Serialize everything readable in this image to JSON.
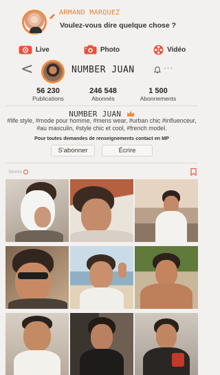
{
  "compose": {
    "user_name": "ARMAND MARQUEZ",
    "prompt": "Voulez-vous dire quelque chose ?"
  },
  "post_types": [
    {
      "label": "Live",
      "icon": "live-icon",
      "color": "#e8523b"
    },
    {
      "label": "Photo",
      "icon": "camera-icon",
      "color": "#e8523b"
    },
    {
      "label": "Vidéo",
      "icon": "film-reel-icon",
      "color": "#e8523b"
    }
  ],
  "profile": {
    "name": "NUMBER JUAN",
    "back_glyph": "<",
    "bell_glyph": "🔔",
    "more_glyph": "···"
  },
  "stats": [
    {
      "value": "56 230",
      "label": "Publications"
    },
    {
      "value": "246 548",
      "label": "Abonnés"
    },
    {
      "value": "1 500",
      "label": "Abonnements"
    }
  ],
  "bio": {
    "name": "NUMBER JUAN",
    "text": "#life style, #mode pour homme, #mens wear, #urban chic #influenceur, #au masculin, #style chic et cool, #french model.",
    "contact": "Pour toutes demandes de renseignements contact en MP"
  },
  "actions": {
    "subscribe_label": "S'abonner",
    "write_label": "Écrire"
  },
  "stories": {
    "label": "Stories"
  },
  "colors": {
    "accent": "#f08a3c",
    "red": "#e8523b",
    "background": "#f3f1ef"
  },
  "photos": [
    {
      "name": "photo-bandaged-face"
    },
    {
      "name": "photo-lying-selfie"
    },
    {
      "name": "photo-terrace-white-shirt"
    },
    {
      "name": "photo-sunglasses-selfie"
    },
    {
      "name": "photo-beach-peace-sign"
    },
    {
      "name": "photo-shirtless-palms"
    },
    {
      "name": "photo-tank-top-smile"
    },
    {
      "name": "photo-dark-shirt-door"
    },
    {
      "name": "photo-dark-jacket-red-pattern"
    }
  ]
}
